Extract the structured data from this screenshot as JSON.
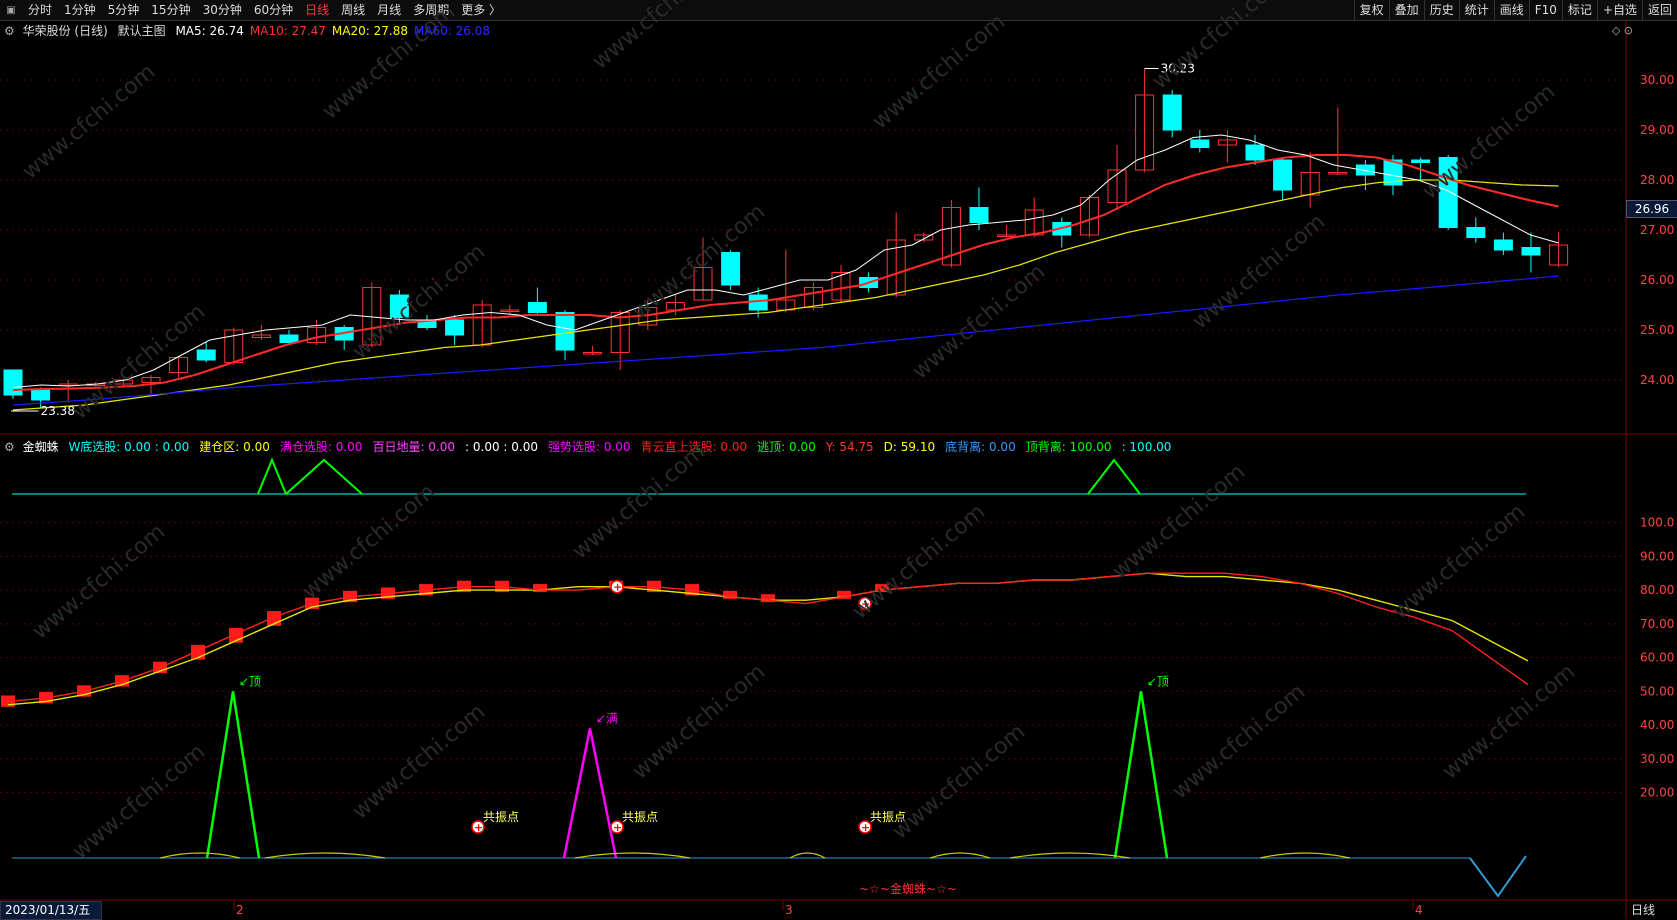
{
  "toolbar": {
    "periods": [
      "分时",
      "1分钟",
      "5分钟",
      "15分钟",
      "30分钟",
      "60分钟",
      "日线",
      "周线",
      "月线",
      "多周期",
      "更多 〉"
    ],
    "active_period": "日线",
    "tools": [
      "复权",
      "叠加",
      "历史",
      "统计",
      "画线",
      "F10",
      "标记",
      "+自选",
      "返回"
    ]
  },
  "info": {
    "stock": "华荣股份 (日线)",
    "theme": "默认主图",
    "ma": [
      {
        "label": "MA5: 26.74",
        "color": "#ffffff"
      },
      {
        "label": "MA10: 27.47",
        "color": "#ff3333"
      },
      {
        "label": "MA20: 27.88",
        "color": "#ffff00"
      },
      {
        "label": "MA60: 26.08",
        "color": "#2b2bff"
      }
    ]
  },
  "indicator_bar": {
    "name": "金蜘蛛",
    "items": [
      {
        "text": "W底选股: 0.00 : 0.00",
        "color": "#00ffff"
      },
      {
        "text": "建仓区: 0.00",
        "color": "#ffff00"
      },
      {
        "text": "满仓选股: 0.00",
        "color": "#ff00ff"
      },
      {
        "text": "百日地量: 0.00",
        "color": "#ff44ff"
      },
      {
        "text": ": 0.00 : 0.00",
        "color": "#ffffff"
      },
      {
        "text": "强势选股: 0.00",
        "color": "#ff00ff"
      },
      {
        "text": "青云直上选股: 0.00",
        "color": "#ff2020"
      },
      {
        "text": "逃顶: 0.00",
        "color": "#00ff00"
      },
      {
        "text": "Y: 54.75",
        "color": "#ff3333"
      },
      {
        "text": "D: 59.10",
        "color": "#ffff00"
      },
      {
        "text": "底背离: 0.00",
        "color": "#3399ff"
      },
      {
        "text": "顶背离: 100.00",
        "color": "#00ff00"
      },
      {
        "text": ": 100.00",
        "color": "#00ffff"
      }
    ]
  },
  "current_price_tag": "26.96",
  "bottom": {
    "date": "2023/01/13/五",
    "period": "日线",
    "months": [
      "2",
      "3",
      "4"
    ]
  },
  "watermark": "www.cfchi.com",
  "colors": {
    "up": "#ff3333",
    "down": "#00ffff",
    "ma5": "#ffffff",
    "ma10": "#ff2a2a",
    "ma20": "#e6e600",
    "ma60": "#1a1aff",
    "grid": "#5a0000"
  },
  "chart_data": [
    {
      "type": "candlestick",
      "title": "华荣股份 (日线)",
      "ylim": [
        23.2,
        30.7
      ],
      "yticks": [
        "30.00",
        "29.00",
        "28.00",
        "27.00",
        "26.00",
        "25.00",
        "24.00"
      ],
      "annotations": {
        "high": "30.23",
        "low": "23.38"
      },
      "candles": [
        [
          24.2,
          23.7,
          24.18,
          23.62
        ],
        [
          23.8,
          23.6,
          23.85,
          23.45
        ],
        [
          23.9,
          23.92,
          24.0,
          23.55
        ],
        [
          23.9,
          23.92,
          23.96,
          23.86
        ],
        [
          23.92,
          24.0,
          24.02,
          23.88
        ],
        [
          23.95,
          24.05,
          24.1,
          23.72
        ],
        [
          24.15,
          24.45,
          24.48,
          24.05
        ],
        [
          24.6,
          24.4,
          24.75,
          24.35
        ],
        [
          24.35,
          25.0,
          25.05,
          24.3
        ],
        [
          24.85,
          24.9,
          25.1,
          24.8
        ],
        [
          24.9,
          24.75,
          25.0,
          24.7
        ],
        [
          24.75,
          25.05,
          25.2,
          24.7
        ],
        [
          25.05,
          24.8,
          25.1,
          24.6
        ],
        [
          24.7,
          25.85,
          25.95,
          24.65
        ],
        [
          25.7,
          25.25,
          25.8,
          25.15
        ],
        [
          25.2,
          25.05,
          25.3,
          25.0
        ],
        [
          25.2,
          24.9,
          25.3,
          24.7
        ],
        [
          24.7,
          25.5,
          25.6,
          24.65
        ],
        [
          25.4,
          25.4,
          25.5,
          25.3
        ],
        [
          25.55,
          25.35,
          25.85,
          25.3
        ],
        [
          25.35,
          24.6,
          25.4,
          24.4
        ],
        [
          24.55,
          24.55,
          24.68,
          24.5
        ],
        [
          24.55,
          25.35,
          25.4,
          24.2
        ],
        [
          25.1,
          25.45,
          25.6,
          25.0
        ],
        [
          25.4,
          25.55,
          25.7,
          25.3
        ],
        [
          25.6,
          26.25,
          26.85,
          25.6
        ],
        [
          26.55,
          25.9,
          26.6,
          25.8
        ],
        [
          25.7,
          25.4,
          25.85,
          25.25
        ],
        [
          25.4,
          25.6,
          26.6,
          25.35
        ],
        [
          25.45,
          25.85,
          25.95,
          25.4
        ],
        [
          25.6,
          26.15,
          26.3,
          25.55
        ],
        [
          26.05,
          25.85,
          26.15,
          25.75
        ],
        [
          25.7,
          26.8,
          27.35,
          25.65
        ],
        [
          26.8,
          26.9,
          26.95,
          26.75
        ],
        [
          26.3,
          27.45,
          27.6,
          26.25
        ],
        [
          27.45,
          27.15,
          27.85,
          27.0
        ],
        [
          26.9,
          26.9,
          27.1,
          26.85
        ],
        [
          26.9,
          27.4,
          27.65,
          26.85
        ],
        [
          27.15,
          26.9,
          27.25,
          26.65
        ],
        [
          26.9,
          27.65,
          27.7,
          26.85
        ],
        [
          27.55,
          28.2,
          28.7,
          27.4
        ],
        [
          28.2,
          29.7,
          30.23,
          28.15
        ],
        [
          29.7,
          29.0,
          29.8,
          28.85
        ],
        [
          28.8,
          28.65,
          29.0,
          28.55
        ],
        [
          28.7,
          28.8,
          29.0,
          28.35
        ],
        [
          28.7,
          28.4,
          28.9,
          28.3
        ],
        [
          28.4,
          27.8,
          28.45,
          27.6
        ],
        [
          27.7,
          28.15,
          28.55,
          27.45
        ],
        [
          28.15,
          28.15,
          29.45,
          28.1
        ],
        [
          28.3,
          28.1,
          28.4,
          27.8
        ],
        [
          28.4,
          27.9,
          28.5,
          27.7
        ],
        [
          28.4,
          28.35,
          28.45,
          28.0
        ],
        [
          28.45,
          27.05,
          28.5,
          27.0
        ],
        [
          27.05,
          26.85,
          27.25,
          26.75
        ],
        [
          26.8,
          26.6,
          26.95,
          26.5
        ],
        [
          26.65,
          26.5,
          26.95,
          26.15
        ],
        [
          26.3,
          26.7,
          26.96,
          26.25
        ]
      ],
      "ma5": [
        23.85,
        23.9,
        23.88,
        23.92,
        24.0,
        24.2,
        24.5,
        24.8,
        24.9,
        25.0,
        25.05,
        25.1,
        25.3,
        25.25,
        25.2,
        25.2,
        25.3,
        25.35,
        25.3,
        25.1,
        25.0,
        25.2,
        25.4,
        25.6,
        25.8,
        25.8,
        25.7,
        25.85,
        26.0,
        26.0,
        26.2,
        26.6,
        26.7,
        27.0,
        27.1,
        27.15,
        27.2,
        27.3,
        27.5,
        28.0,
        28.4,
        28.6,
        28.85,
        28.9,
        28.8,
        28.6,
        28.5,
        28.3,
        28.2,
        28.1,
        28.0,
        27.8,
        27.5,
        27.2,
        26.9,
        26.74
      ],
      "ma10": [
        23.8,
        23.82,
        23.83,
        23.85,
        23.88,
        23.95,
        24.1,
        24.3,
        24.5,
        24.7,
        24.85,
        24.95,
        25.05,
        25.15,
        25.2,
        25.25,
        25.25,
        25.3,
        25.3,
        25.3,
        25.25,
        25.3,
        25.4,
        25.5,
        25.55,
        25.6,
        25.7,
        25.8,
        25.9,
        26.1,
        26.3,
        26.5,
        26.7,
        26.85,
        26.95,
        27.1,
        27.3,
        27.6,
        27.9,
        28.1,
        28.25,
        28.35,
        28.45,
        28.5,
        28.5,
        28.45,
        28.3,
        28.1,
        27.9,
        27.75,
        27.6,
        27.47
      ],
      "ma20": [
        23.4,
        23.45,
        23.5,
        23.6,
        23.7,
        23.8,
        23.9,
        24.05,
        24.2,
        24.35,
        24.45,
        24.55,
        24.65,
        24.7,
        24.8,
        24.9,
        25.0,
        25.1,
        25.2,
        25.25,
        25.3,
        25.35,
        25.45,
        25.55,
        25.65,
        25.8,
        25.95,
        26.1,
        26.3,
        26.55,
        26.75,
        26.95,
        27.1,
        27.25,
        27.4,
        27.55,
        27.7,
        27.85,
        27.95,
        28.0,
        28.0,
        27.95,
        27.9,
        27.88
      ],
      "ma60": [
        23.5,
        23.6,
        23.72,
        23.85,
        23.95,
        24.05,
        24.15,
        24.25,
        24.35,
        24.45,
        24.55,
        24.65,
        24.8,
        24.95,
        25.1,
        25.25,
        25.4,
        25.55,
        25.7,
        25.82,
        25.95,
        26.08
      ]
    },
    {
      "type": "line",
      "name": "金蜘蛛",
      "ylim": [
        0,
        115
      ],
      "yticks": [
        "100.0",
        "90.00",
        "80.00",
        "70.00",
        "60.00",
        "50.00",
        "40.00",
        "30.00",
        "20.00"
      ],
      "Y_line": [
        47,
        48,
        50,
        53,
        57,
        62,
        67,
        72,
        76,
        78,
        79,
        80,
        81,
        81,
        80,
        80,
        81,
        81,
        80,
        78,
        77,
        76,
        78,
        80,
        81,
        82,
        82,
        83,
        83,
        84,
        85,
        85,
        85,
        84,
        82,
        79,
        75,
        72,
        68,
        60,
        52
      ],
      "D_line": [
        46,
        47,
        49,
        52,
        56,
        60,
        65,
        70,
        75,
        77,
        78,
        79,
        80,
        80,
        80,
        81,
        81,
        80,
        79,
        78,
        77,
        77,
        78,
        80,
        81,
        82,
        82,
        83,
        83,
        84,
        85,
        84,
        84,
        83,
        82,
        80,
        77,
        74,
        71,
        65,
        59
      ],
      "top_labels": [
        "顶",
        "顶"
      ],
      "full_label": "满",
      "resonance_label": "共振点",
      "footer": "~☆~金蜘蛛~☆~"
    }
  ]
}
